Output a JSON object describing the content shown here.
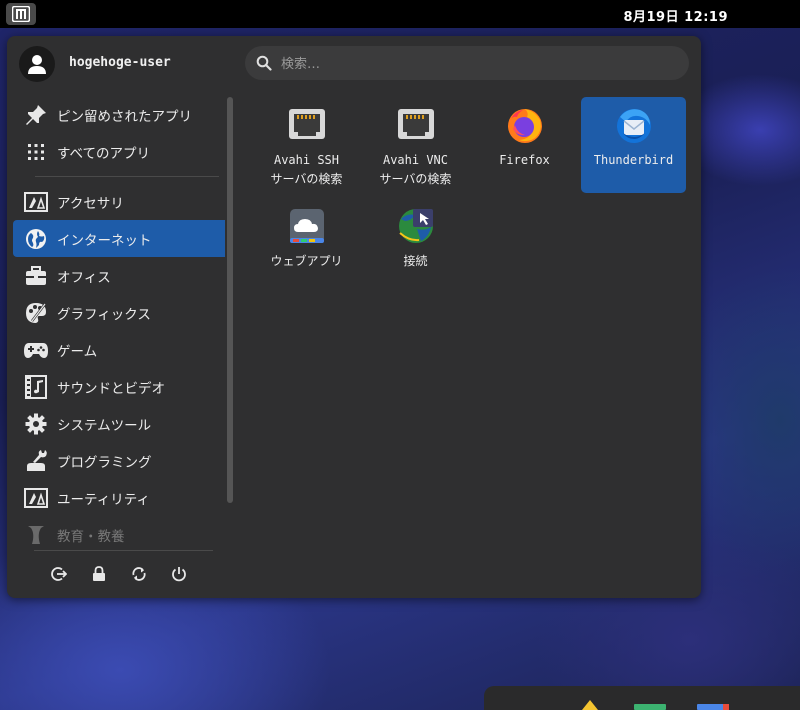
{
  "topbar": {
    "clock": "8月19日  12:19"
  },
  "user": {
    "name": "hogehoge-user"
  },
  "search": {
    "placeholder": "検索…"
  },
  "sidebar": {
    "top_items": [
      {
        "label": "ピン留めされたアプリ",
        "icon": "pin-icon"
      },
      {
        "label": "すべてのアプリ",
        "icon": "grid-icon"
      }
    ],
    "categories": [
      {
        "label": "アクセサリ",
        "icon": "accessories-icon"
      },
      {
        "label": "インターネット",
        "icon": "globe-icon",
        "active": true
      },
      {
        "label": "オフィス",
        "icon": "briefcase-icon"
      },
      {
        "label": "グラフィックス",
        "icon": "palette-icon"
      },
      {
        "label": "ゲーム",
        "icon": "gamepad-icon"
      },
      {
        "label": "サウンドとビデオ",
        "icon": "film-icon"
      },
      {
        "label": "システムツール",
        "icon": "gear-icon"
      },
      {
        "label": "プログラミング",
        "icon": "wrench-icon"
      },
      {
        "label": "ユーティリティ",
        "icon": "utilities-icon"
      },
      {
        "label": "教育・教養",
        "icon": "education-icon",
        "dimmed": true
      }
    ]
  },
  "apps": [
    {
      "line1": "Avahi SSH",
      "line2": "サーバの検索",
      "icon": "network-icon"
    },
    {
      "line1": "Avahi VNC",
      "line2": "サーバの検索",
      "icon": "network-icon"
    },
    {
      "line1": "Firefox",
      "icon": "firefox-icon"
    },
    {
      "line1": "Thunderbird",
      "icon": "thunderbird-icon",
      "selected": true
    },
    {
      "line1": "ウェブアプリ",
      "icon": "webapp-icon"
    },
    {
      "line1": "接続",
      "icon": "remote-connection-icon"
    }
  ],
  "bottom_actions": [
    {
      "icon": "logout-icon"
    },
    {
      "icon": "lock-icon"
    },
    {
      "icon": "switch-user-icon"
    },
    {
      "icon": "power-icon"
    }
  ],
  "colors": {
    "accent": "#1e5ca9",
    "menu_bg": "#2f2f30",
    "panel_bg": "#000000"
  }
}
